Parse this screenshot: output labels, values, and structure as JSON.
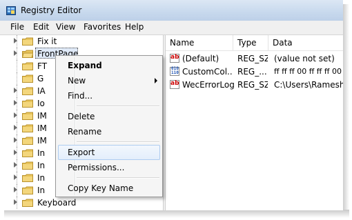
{
  "window": {
    "title": "Registry Editor"
  },
  "menu": [
    "File",
    "Edit",
    "View",
    "Favorites",
    "Help"
  ],
  "tree": {
    "items": [
      {
        "label": "Fix it"
      },
      {
        "label": "FrontPage",
        "selected": true
      },
      {
        "label": "FT"
      },
      {
        "label": "G"
      },
      {
        "label": "IA"
      },
      {
        "label": "Io"
      },
      {
        "label": "IM"
      },
      {
        "label": "IM"
      },
      {
        "label": "IM"
      },
      {
        "label": "In"
      },
      {
        "label": "In"
      },
      {
        "label": "In"
      },
      {
        "label": "In"
      },
      {
        "label": "Keyboard"
      }
    ]
  },
  "values_pane": {
    "columns": [
      "Name",
      "Type",
      "Data"
    ],
    "rows": [
      {
        "name": "(Default)",
        "type": "REG_SZ",
        "data": "(value not set)",
        "icon": "string-value-icon"
      },
      {
        "name": "CustomCol...",
        "type": "REG_...",
        "data": "ff ff ff 00 ff ff ff 00",
        "icon": "binary-value-icon"
      },
      {
        "name": "WecErrorLog",
        "type": "REG_SZ",
        "data": "C:\\Users\\Ramesh\\",
        "icon": "string-value-icon"
      }
    ]
  },
  "context_menu": {
    "items": [
      {
        "label": "Expand",
        "bold": true
      },
      {
        "label": "New",
        "submenu": true
      },
      {
        "label": "Find..."
      },
      {
        "label": "Delete"
      },
      {
        "label": "Rename"
      },
      {
        "label": "Export",
        "highlighted": true
      },
      {
        "label": "Permissions..."
      },
      {
        "label": "Copy Key Name"
      }
    ]
  },
  "colors": {
    "folder": "#e8c45a",
    "highlight": "#aeccf0",
    "title_bar": "#c9daee"
  }
}
